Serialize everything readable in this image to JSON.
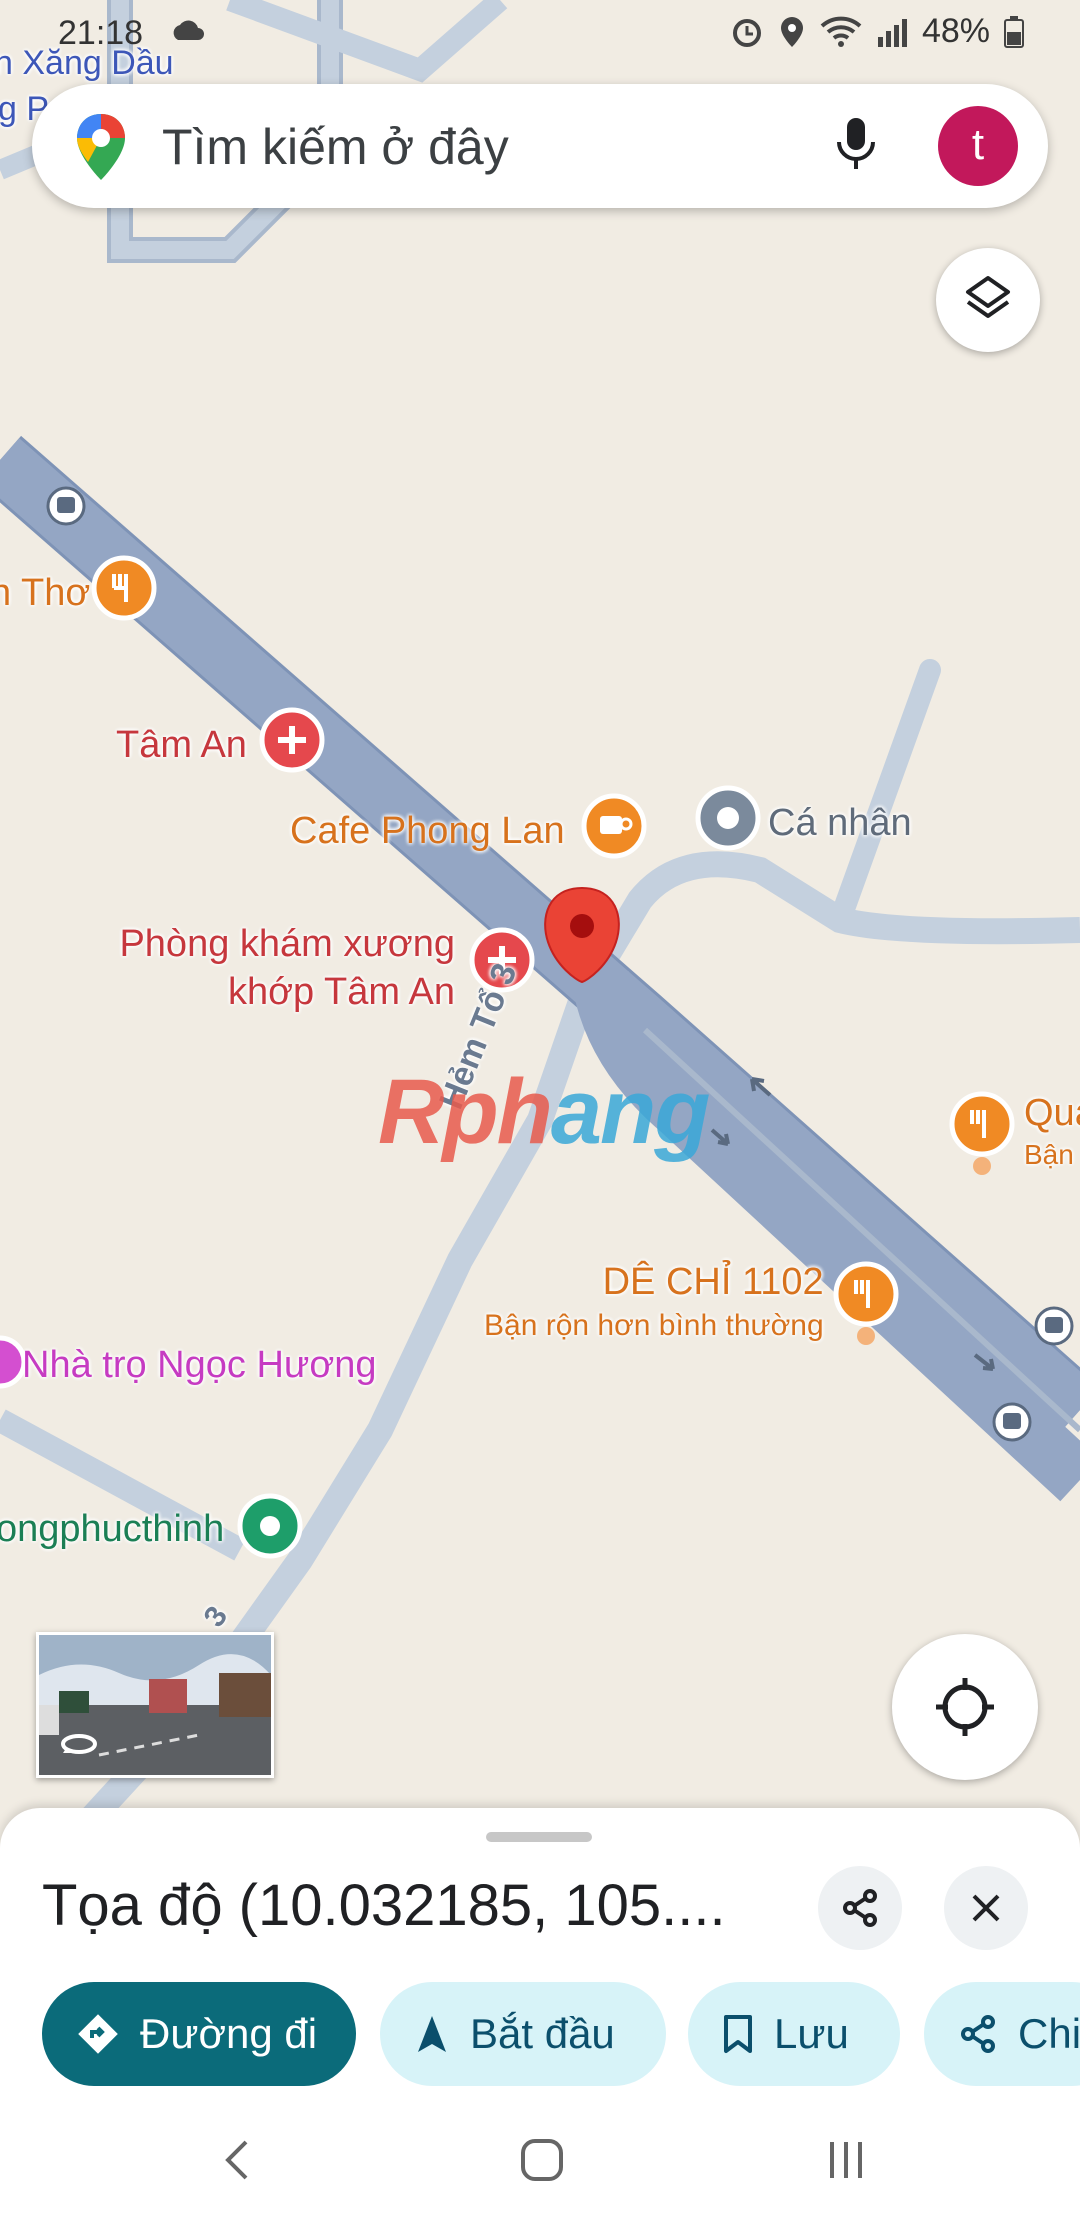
{
  "status_bar": {
    "time": "21:18",
    "battery": "48%"
  },
  "search": {
    "placeholder": "Tìm kiếm ở đây",
    "avatar_letter": "t"
  },
  "map": {
    "places": {
      "xang_dau": "n Xăng Dầu",
      "top_partial": "g P",
      "tho": "n Thơ",
      "tam_an": "Tâm An",
      "cafe": "Cafe Phong Lan",
      "ca_nhan": "Cá nhân",
      "phong_kham_1": "Phòng khám xương",
      "phong_kham_2": "khớp Tâm An",
      "quan": "Qua",
      "quan_status": "Bận",
      "de_chi": "DÊ CHỈ 1102",
      "de_chi_status": "Bận rộn hơn bình thường",
      "nha_tro": "Nhà trọ Ngọc Hương",
      "phucthinh": "ongphucthinh",
      "road_hem": "Hẻm Tổ 3",
      "road_small": "3"
    },
    "watermark_a": "Rph",
    "watermark_b": "ang"
  },
  "sheet": {
    "title": "Tọa độ (10.032185, 105....",
    "actions": {
      "directions": "Đường đi",
      "start": "Bắt đầu",
      "save": "Lưu",
      "share": "Chi"
    }
  },
  "colors": {
    "primary_teal": "#0b6b7a",
    "chip_bg": "#d7f3f8",
    "pin_red": "#ea4335",
    "avatar": "#c2185b",
    "restaurant_orange": "#f08a24",
    "health_red": "#e5484d"
  }
}
